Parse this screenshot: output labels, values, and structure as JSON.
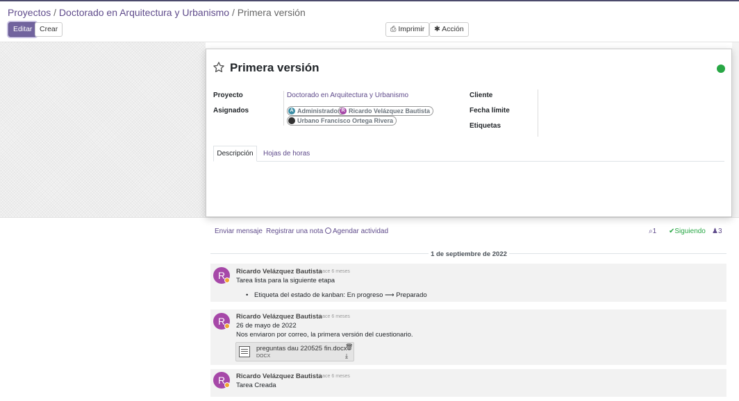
{
  "breadcrumb": {
    "projects": "Proyectos",
    "sep": "/",
    "project": "Doctorado en Arquitectura y Urbanismo",
    "current": "Primera versión"
  },
  "toolbar": {
    "edit": "Editar",
    "create": "Crear",
    "print": "Imprimir",
    "action": "Acción"
  },
  "task": {
    "title": "Primera versión",
    "status_color": "#28a745",
    "fields": {
      "project_label": "Proyecto",
      "project_value": "Doctorado en Arquitectura y Urbanismo",
      "assignees_label": "Asignados",
      "assignees": [
        {
          "name": "Administrador",
          "initial": "A",
          "color": "#3d8ea5"
        },
        {
          "name": "Ricardo Velázquez Bautista",
          "initial": "R",
          "color": "#a648a8"
        },
        {
          "name": "Urbano Francisco Ortega Rivera",
          "initial": "",
          "color": "#333333"
        }
      ],
      "customer_label": "Cliente",
      "deadline_label": "Fecha límite",
      "tags_label": "Etiquetas"
    },
    "tabs": [
      "Descripción",
      "Hojas de horas"
    ]
  },
  "chatter": {
    "send_message": "Enviar mensaje",
    "log_note": "Registrar una nota",
    "schedule_activity": "Agendar actividad",
    "attachments_count": "1",
    "following": "Siguiendo",
    "followers_count": "3",
    "date_separator": "1 de septiembre de 2022",
    "messages": [
      {
        "author": "Ricardo Velázquez Bautista",
        "initial": "R",
        "ago": "- hace 6 meses",
        "body": "Tarea lista para la siguiente etapa",
        "tracking": "Etiqueta del estado de kanban: En progreso ⟶ Preparado"
      },
      {
        "author": "Ricardo Velázquez Bautista",
        "initial": "R",
        "ago": "- hace 6 meses",
        "line1": "26 de mayo de 2022",
        "line2": "Nos enviaron por correo, la primera versión del cuestionario.",
        "attachment": {
          "name": "preguntas dau 220525 fin.docx",
          "ext": "DOCX"
        }
      },
      {
        "author": "Ricardo Velázquez Bautista",
        "initial": "R",
        "ago": "- hace 6 meses",
        "body": "Tarea Creada"
      }
    ]
  }
}
